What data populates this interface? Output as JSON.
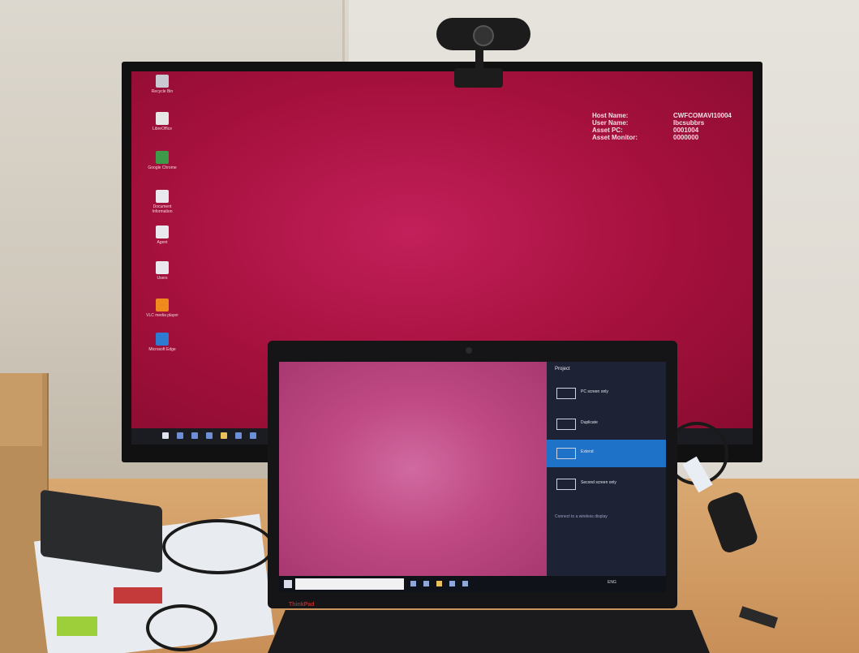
{
  "scene": {
    "description_items": [
      "external-monitor",
      "laptop",
      "webcam",
      "charger",
      "cables"
    ]
  },
  "monitor": {
    "asset_info": [
      {
        "key": "Host Name:",
        "value": "CWFCOMAVI10004"
      },
      {
        "key": "User Name:",
        "value": "Ibcsubbrs"
      },
      {
        "key": "Asset PC:",
        "value": "0001004"
      },
      {
        "key": "Asset Monitor:",
        "value": "0000000"
      }
    ],
    "desktop_icons": [
      {
        "label": "Recycle Bin",
        "color": "#c9c9d2"
      },
      {
        "label": "LibreOffice",
        "color": "#e6e6e6"
      },
      {
        "label": "Google Chrome",
        "color": "#3c9a48"
      },
      {
        "label": "Document Information",
        "color": "#e8e8ee"
      },
      {
        "label": "Agent",
        "color": "#e8e8ee"
      },
      {
        "label": "Users",
        "color": "#e8e8ee"
      },
      {
        "label": "VLC media player",
        "color": "#f08a1c"
      },
      {
        "label": "Microsoft Edge",
        "color": "#2d7bd0"
      }
    ]
  },
  "laptop": {
    "project_title": "Project",
    "options": [
      {
        "label": "PC screen only",
        "selected": false
      },
      {
        "label": "Duplicate",
        "selected": false
      },
      {
        "label": "Extend",
        "selected": true
      },
      {
        "label": "Second screen only",
        "selected": false
      }
    ],
    "connect_link": "Connect to a wireless display",
    "tray_text": "ENG",
    "brand": "ThinkPad"
  },
  "colors": {
    "monitor_wallpaper": "#a4103c",
    "laptop_wallpaper": "#c04a84",
    "selected_option": "#1e73c9"
  }
}
